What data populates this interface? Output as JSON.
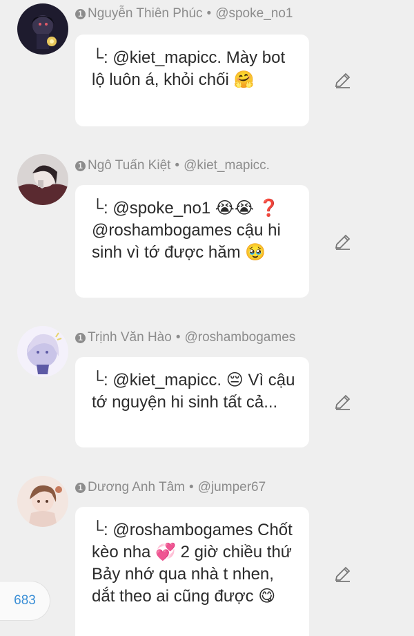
{
  "comments": [
    {
      "name": "Nguyễn Thiên Phúc",
      "handle": "@spoke_no1",
      "badge": "1",
      "text": "└: @kiet_mapicc. Mày bot lộ luôn á, khỏi chối 🤗",
      "avatar_colors": [
        "#1e1b2e",
        "#e7c75c"
      ]
    },
    {
      "name": "Ngô Tuấn Kiệt",
      "handle": "@kiet_mapicc.",
      "badge": "1",
      "text": "└: @spoke_no1 😭😭 ❓ @roshambogames cậu hi sinh vì tớ được hăm 🥹",
      "avatar_colors": [
        "#5a2a30",
        "#c8c0bf"
      ]
    },
    {
      "name": "Trịnh Văn Hào",
      "handle": "@roshambogames",
      "badge": "1",
      "text": "└: @kiet_mapicc. 😔 Vì cậu tớ nguyện hi sinh tất cả...",
      "avatar_colors": [
        "#dcd6ef",
        "#5d5aa5"
      ]
    },
    {
      "name": "Dương Anh Tâm",
      "handle": "@jumper67",
      "badge": "1",
      "text": "└: @roshambogames Chốt kèo nha 💞 2 giờ chiều thứ Bảy nhớ qua nhà t nhen, dắt theo ai cũng được 😋",
      "avatar_colors": [
        "#ead1c8",
        "#8a5a42"
      ]
    }
  ],
  "like_count": "683",
  "separator": "•",
  "edit_icon": "pencil-icon"
}
